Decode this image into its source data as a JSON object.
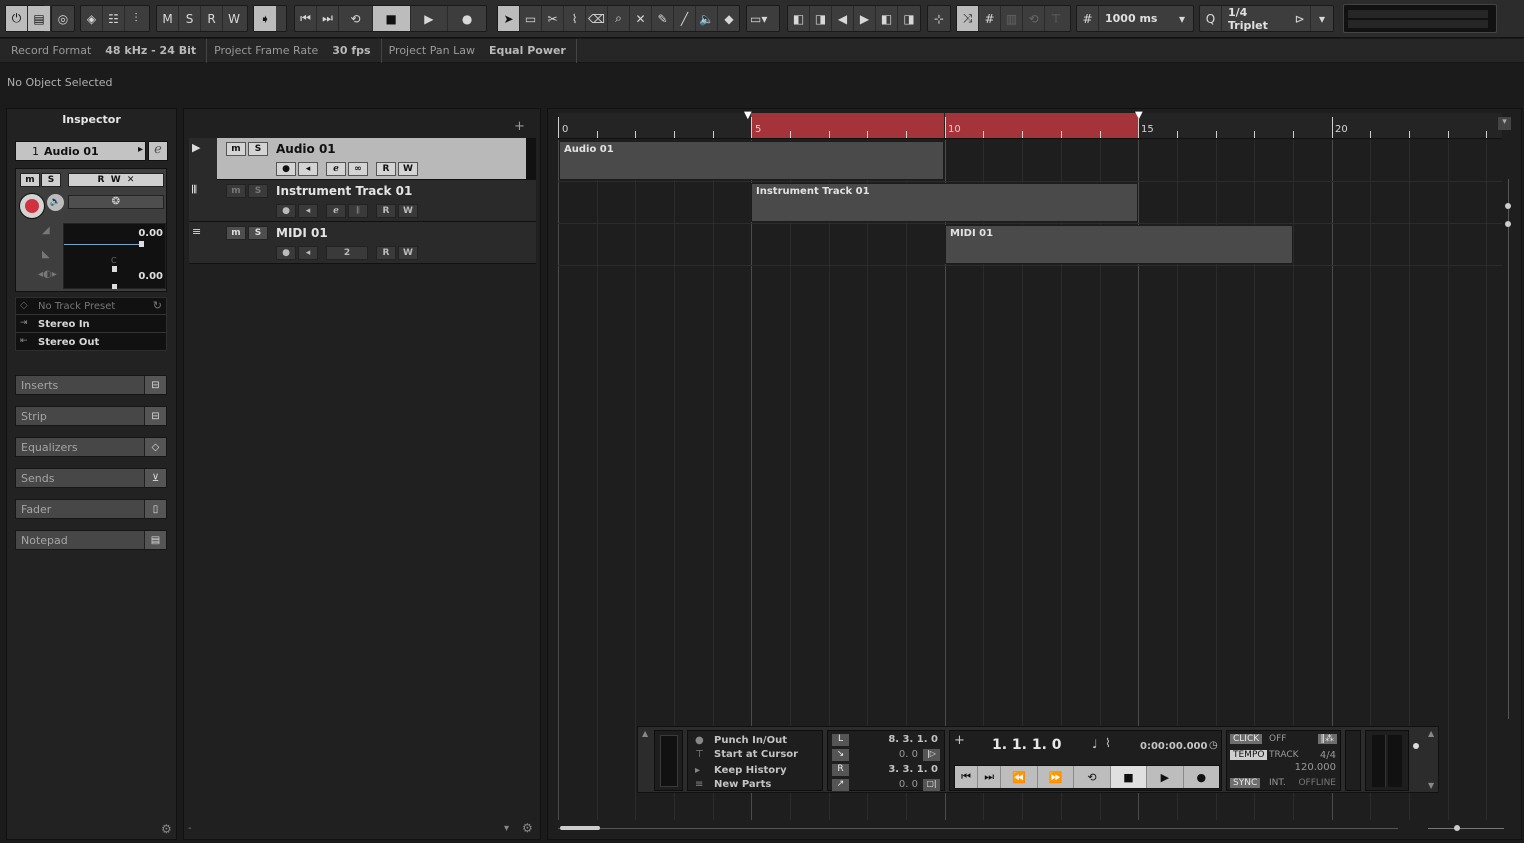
{
  "toolbar": {
    "automation_buttons": [
      "M",
      "S",
      "R",
      "W"
    ],
    "grid_value": "1000 ms",
    "quantize_value": "1/4  Triplet",
    "quantize_prefix": "Q"
  },
  "statusbar": {
    "record_format_label": "Record Format",
    "record_format_value": "48 kHz - 24 Bit",
    "frame_rate_label": "Project Frame Rate",
    "frame_rate_value": "30 fps",
    "pan_law_label": "Project Pan Law",
    "pan_law_value": "Equal Power"
  },
  "info_line": "No Object Selected",
  "inspector": {
    "title": "Inspector",
    "track_number": "1",
    "track_name": "Audio 01",
    "volume_value": "0.00",
    "pan_value": "0.00",
    "pan_center": "C",
    "track_preset": "No Track Preset",
    "input_routing": "Stereo In",
    "output_routing": "Stereo Out",
    "sections": [
      "Inserts",
      "Strip",
      "Equalizers",
      "Sends",
      "Fader",
      "Notepad"
    ]
  },
  "tracklist": {
    "add_button": "+",
    "tracks": [
      {
        "name": "Audio 01",
        "type": "audio"
      },
      {
        "name": "Instrument Track 01",
        "type": "instrument"
      },
      {
        "name": "MIDI 01",
        "type": "midi"
      }
    ],
    "midi_channel": "2"
  },
  "arrange": {
    "ruler_labels": [
      "0",
      "5",
      "10",
      "15",
      "20"
    ],
    "events": [
      {
        "name": "Audio 01"
      },
      {
        "name": "Instrument Track 01"
      },
      {
        "name": "MIDI 01"
      }
    ]
  },
  "transport": {
    "punch": "Punch In/Out",
    "start_at_cursor": "Start at Cursor",
    "keep_history": "Keep History",
    "new_parts": "New Parts",
    "left_locator": "8.  3.  1.    0",
    "left_locator_sub": "0.    0",
    "right_locator": "3.  3.  1.    0",
    "right_locator_sub": "0.    0",
    "position": "1.  1.  1.     0",
    "time_position": "0:00:00.000",
    "click_label": "CLICK",
    "click_value": "OFF",
    "tempo_label": "TEMPO",
    "tempo_mode": "TRACK",
    "signature": "4/4",
    "tempo_value": "120.000",
    "sync_label": "SYNC",
    "sync_source": "INT.",
    "sync_status": "OFFLINE",
    "locator_left_letter": "L",
    "locator_right_letter": "R"
  }
}
